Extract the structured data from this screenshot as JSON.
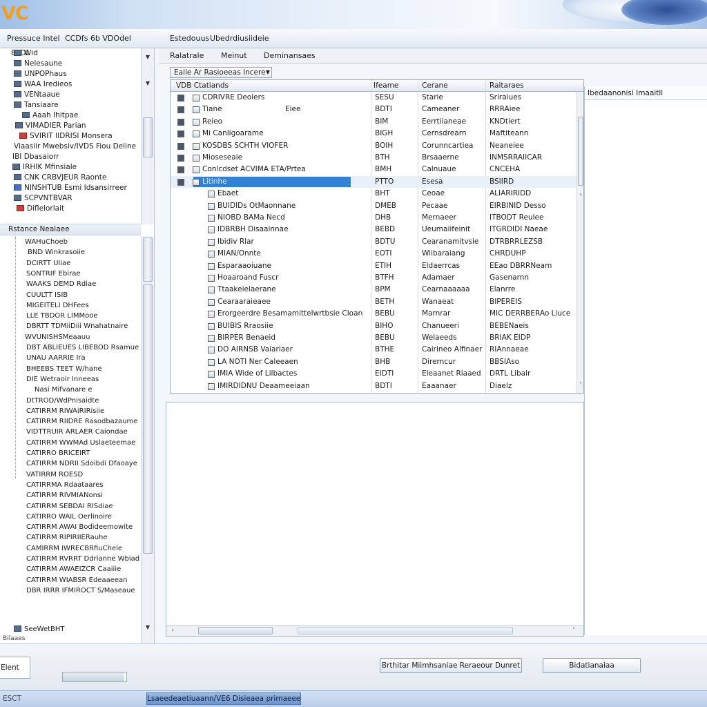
{
  "window": {
    "brand": "VC"
  },
  "menubar": {
    "items": [
      "Pressuce Intel",
      "CCDfs 6b VDOdel",
      "Estedouus",
      "Ubedrdiusiideie"
    ]
  },
  "left_tree": {
    "items": [
      {
        "label": "Wid",
        "icon": "dark"
      },
      {
        "label": "Nelesaune",
        "icon": "dark"
      },
      {
        "label": "UNPOPhaus",
        "icon": "dark"
      },
      {
        "label": "WAA Iredieos",
        "icon": "dark"
      },
      {
        "label": "VENtaaue",
        "icon": "dark"
      },
      {
        "label": "Tansiaare",
        "icon": "dark"
      },
      {
        "label": "Aaah Ihitpae",
        "icon": "dark"
      },
      {
        "label": "VIMADIER Parian",
        "icon": "dark"
      },
      {
        "label": "SVIRIT IIDRISI Monsera",
        "icon": "red"
      },
      {
        "label": "Viaasiir Mwebsiv/IVDS Fiou Deline",
        "icon": "none"
      },
      {
        "label": "IBI Dbasaiorr",
        "icon": "none"
      },
      {
        "label": "IRHIK Mfinsiale",
        "icon": "dark"
      },
      {
        "label": "CNK CRBVJEUR Raonte",
        "icon": "dark"
      },
      {
        "label": "NINSHTUB Esmi Idsansirreer",
        "icon": "blue"
      },
      {
        "label": "SCPVNTBVAR",
        "icon": "dark"
      },
      {
        "label": "Diflelorlait",
        "icon": "red"
      }
    ],
    "section_header": "Rstance Nealaee",
    "sub_items": [
      "WAHuChoeb",
      "BND Winkrasoiie",
      "DCIRTT Uliae",
      "SONTRIF Ebirae",
      "WAAKS DEMD Rdiae",
      "CUULTT ISIB",
      "MIGEITELI DHFees",
      "LLE TBDOR LIMMooe",
      "DBRTT TDMiiDiii Wnahatnaire",
      "WVUNISHSMeaauu",
      "DBT ABLIEUES LIBEBOD Rsamue",
      "UNAU AARRIE Ira",
      "BHEEBS TEET W/hane",
      "DIE Wetraoir Inneeas",
      "Nasi Mifvanare e",
      "DtTROD/WdPnisaidte",
      "CATIRRM RIWAiRIRisiie",
      "CATIRRM RIIDRE Rasodbazaume",
      "VIDTTRUIR ARLAER Caiondae",
      "CATIRRM WWMAd Uslaeteemae",
      "CATIRRO BRICEIRT",
      "CATIRRM NDRII Sdoibdi Dfaoaye",
      "VATIRRM ROESD",
      "CATIRRMA Rdaataares",
      "CATIRRM RIVMIANonsi",
      "CATIRRM SEBDAI RISdiae",
      "CATIRRO WAIL Oerlinoire",
      "CATIRRM AWAI Bodideemowite",
      "CATIRRM RIPIRIIERauhe",
      "CAMIRRM IWRECBRfiuChele",
      "CATIRRM RVRRT Ddrianne Wbiad",
      "CATIRRM AWAEIZCR Caaiiie",
      "CATIRRM WIABSR Edeaaeean",
      "DBR IRRR IFMIROCT S/Maseaue",
      "SeeWetBHT"
    ],
    "footer": "Bilaaes"
  },
  "tabs": [
    "Ralatrale",
    "Meinut",
    "Deminansaes"
  ],
  "filter": {
    "combo_value": "Ealle Ar Rasioeeas Incere"
  },
  "grid": {
    "columns": [
      "VDB Ctatiands",
      "Ifeame",
      "Cerane",
      "Raitaraes"
    ],
    "rows": [
      {
        "name": "CDRIVRE Deolers",
        "extra": "",
        "id": "SESU",
        "c3": "Starie",
        "c4": "Sriraiues",
        "level": 0
      },
      {
        "name": "Tiane",
        "extra": "Eiee",
        "id": "BDTI",
        "c3": "Cameaner",
        "c4": "RRRAiee",
        "level": 0
      },
      {
        "name": "Reieo",
        "extra": "",
        "id": "BIM",
        "c3": "Eerrtiianeae",
        "c4": "KNDtiert",
        "level": 0
      },
      {
        "name": "Mi Canligoarame",
        "extra": "",
        "id": "BIGH",
        "c3": "Cernsdrearn",
        "c4": "Maftiteann",
        "level": 0
      },
      {
        "name": "KOSDBS SCHTH VIOFER",
        "extra": "",
        "id": "BOIH",
        "c3": "Corunncartiea",
        "c4": "Neaneiee",
        "level": 0
      },
      {
        "name": "Mioseseaie",
        "extra": "",
        "id": "BTH",
        "c3": "Brsaaerne",
        "c4": "INMSRRAIICAR",
        "level": 0
      },
      {
        "name": "Conlcdset ACVIMA ETA/Prteaoone",
        "extra": "",
        "id": "BMH",
        "c3": "Calnuaue",
        "c4": "CNCEHA",
        "level": 0
      },
      {
        "name": "Litinhe",
        "extra": "",
        "id": "PTTO",
        "c3": "Esesa",
        "c4": "BSIIRD",
        "level": 0,
        "selected": true
      },
      {
        "name": "Ebaet",
        "extra": "",
        "id": "BHT",
        "c3": "Ceoae",
        "c4": "ALIARIRIDD",
        "level": 1
      },
      {
        "name": "BUIDIDs OtMaonnane",
        "extra": "",
        "id": "DMEB",
        "c3": "Pecaae",
        "c4": "EIRBINID Desso",
        "level": 1
      },
      {
        "name": "NIOBD BAMa Necd",
        "extra": "",
        "id": "DHB",
        "c3": "Mernaeer",
        "c4": "ITBODT Reulee",
        "level": 1
      },
      {
        "name": "IDBRBH Disaainnae",
        "extra": "",
        "id": "BEBD",
        "c3": "Ueumaiifeinit",
        "c4": "ITGRDIDI Naeae",
        "level": 1
      },
      {
        "name": "Ibidiv Rlar",
        "extra": "",
        "id": "BDTU",
        "c3": "Cearanamitvsie",
        "c4": "DTRBRRLEZSB",
        "level": 1
      },
      {
        "name": "MIAN/Onnte",
        "extra": "",
        "id": "EOTI",
        "c3": "Wiibaraiang",
        "c4": "CHRDUHP",
        "level": 1
      },
      {
        "name": "Esparaaoiuane",
        "extra": "",
        "id": "ETIH",
        "c3": "Eldaerrcas",
        "c4": "EEao DBRRNeam",
        "level": 1
      },
      {
        "name": "Hoaaroand Fuscr",
        "extra": "",
        "id": "BTFH",
        "c3": "Adamaer",
        "c4": "Gasenarnn",
        "level": 1
      },
      {
        "name": "Ttaakeielaerane",
        "extra": "",
        "id": "BPM",
        "c3": "Cearnaaaaaa",
        "c4": "Elanrre",
        "level": 1
      },
      {
        "name": "Cearaaraieaee",
        "extra": "",
        "id": "BETH",
        "c3": "Wanaeat",
        "c4": "BIPEREIS",
        "level": 1
      },
      {
        "name": "Erorgeerdre Besamamittelwrtbsie Cloardiae",
        "extra": "",
        "id": "BEBU",
        "c3": "Marnrar",
        "c4": "MIC DERRBERAo Liuce",
        "level": 1
      },
      {
        "name": "BUIBIS Rraosiie",
        "extra": "",
        "id": "BIHO",
        "c3": "Chanueeri",
        "c4": "BEBENaeis",
        "level": 1
      },
      {
        "name": "BIRPER Benaeid",
        "extra": "",
        "id": "BEBU",
        "c3": "Welaeeds",
        "c4": "BRIAK EIDP",
        "level": 1
      },
      {
        "name": "DO AIRNSB Vaiariaer",
        "extra": "",
        "id": "BTHE",
        "c3": "Cairineo Alfinaer",
        "c4": "RIAnnaeae",
        "level": 1
      },
      {
        "name": "LA NOTI Ner Caleeaen",
        "extra": "",
        "id": "BHB",
        "c3": "Direrncur",
        "c4": "BBSIAso",
        "level": 1
      },
      {
        "name": "IMIA Wide of Lilbactes",
        "extra": "",
        "id": "EIDTI",
        "c3": "Eleaanet Riaaed",
        "c4": "DRTL Libalr",
        "level": 1
      },
      {
        "name": "IMIRDIDNU Deaameeiaan",
        "extra": "",
        "id": "BDTI",
        "c3": "Eaaanaer",
        "c4": "Diaelz",
        "level": 1
      }
    ]
  },
  "info_panel": {
    "header": "Ibedaanonisi Imaaitll"
  },
  "bottom": {
    "left_box": "Elent",
    "progress_fraction": 0.97,
    "button1": "Brthitar Miimhsaniae Reraeour Dunret",
    "button2": "Bidatianaiaa"
  },
  "taskbar": {
    "left_text": "ESCT",
    "active_label": "Lsaeedeaetiuaann/VE6 Disieaea primaeee"
  },
  "colors": {
    "accent": "#3181d5",
    "brand": "#f0a020"
  }
}
